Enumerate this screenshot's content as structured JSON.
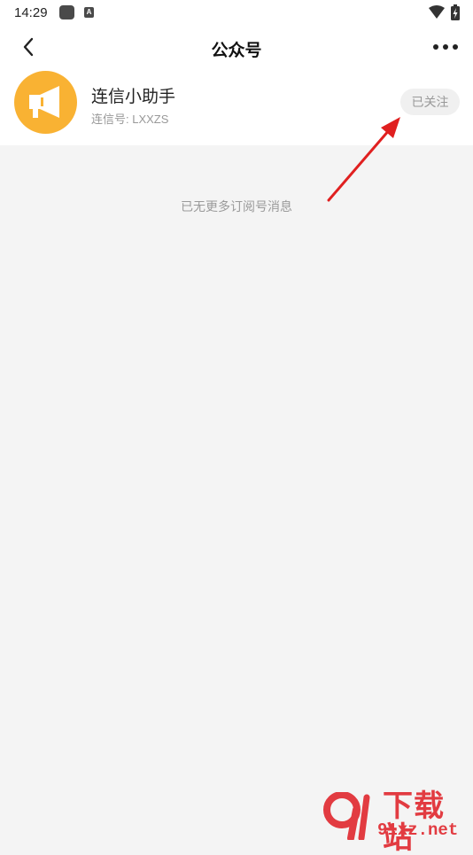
{
  "status_bar": {
    "time": "14:29",
    "notification_badge": "A"
  },
  "header": {
    "title": "公众号"
  },
  "account": {
    "name": "连信小助手",
    "id_label": "连信号: LXXZS",
    "follow_label": "已关注",
    "avatar_color": "#f9b233"
  },
  "empty_message": "已无更多订阅号消息",
  "watermark": {
    "text": "下载站",
    "site": "91xz.net",
    "number": "9"
  },
  "colors": {
    "accent_orange": "#f9b233",
    "annotation_red": "#e02020",
    "watermark_red": "#e23b41"
  },
  "icons": [
    "back-arrow-icon",
    "more-icon",
    "megaphone-icon",
    "wifi-icon",
    "battery-icon"
  ]
}
